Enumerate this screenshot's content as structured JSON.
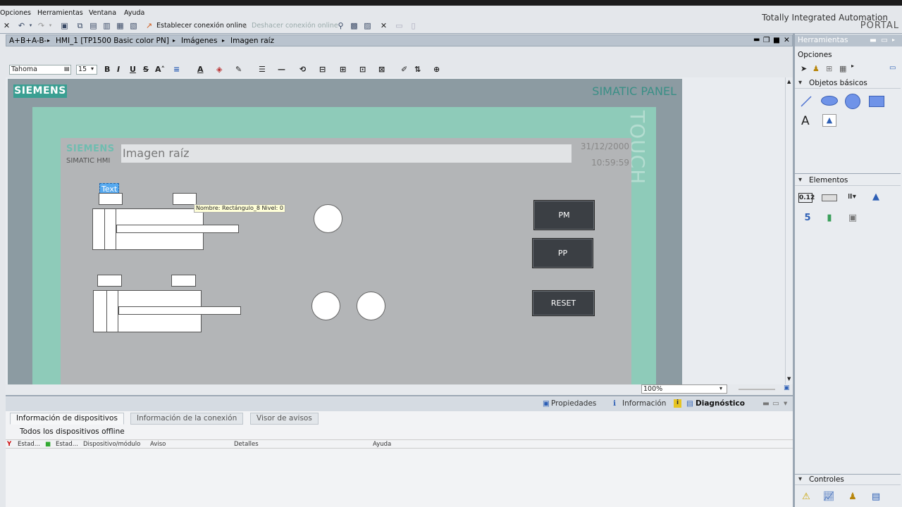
{
  "menu": {
    "opciones": "Opciones",
    "herramientas": "Herramientas",
    "ventana": "Ventana",
    "ayuda": "Ayuda"
  },
  "brand": {
    "line1": "Totally Integrated Automation",
    "line2": "PORTAL"
  },
  "toolbar": {
    "connect_label": "Establecer conexión online",
    "disconnect_label": "Deshacer conexión online"
  },
  "breadcrumb": {
    "project": "A+B+A-B-",
    "device": "HMI_1 [TP1500 Basic color PN]",
    "folder": "Imágenes",
    "screen": "Imagen raíz"
  },
  "format": {
    "font_name": "Tahoma",
    "font_size": "15"
  },
  "panel": {
    "brand": "SIEMENS",
    "model": "SIMATIC PANEL",
    "touch": "TOUCH"
  },
  "hmi": {
    "brand": "SIEMENS",
    "product": "SIMATIC HMI",
    "title": "Imagen raíz",
    "date": "31/12/2000",
    "time": "10:59:59",
    "text_object": "Text",
    "tooltip": "Nombre: Rectángulo_8   Nivel: 0",
    "buttons": {
      "pm": "PM",
      "pp": "PP",
      "reset": "RESET"
    }
  },
  "zoom": "100%",
  "inspector_tabs": {
    "properties": "Propiedades",
    "info": "Información",
    "diagnostics": "Diagnóstico"
  },
  "bottom": {
    "tabs": [
      "Información de dispositivos",
      "Información de la conexión",
      "Visor de avisos"
    ],
    "status_line": "Todos los dispositivos offline",
    "columns": [
      "Estad...",
      "Estad...",
      "Dispositivo/módulo",
      "Aviso",
      "Detalles",
      "Ayuda"
    ]
  },
  "tools": {
    "header": "Herramientas",
    "sections": {
      "options": "Opciones",
      "basic_objects": "Objetos básicos",
      "elements": "Elementos",
      "controls": "Controles"
    },
    "text_tool": "A"
  },
  "colors": {
    "siemens_teal": "#3a9f92",
    "bezel": "#8ecbb9",
    "hmi_screen": "#b3b5b7",
    "button_dark": "#3b3f44",
    "tooltip_bg": "#ffffd8",
    "selection_blue": "#56a9ef"
  }
}
